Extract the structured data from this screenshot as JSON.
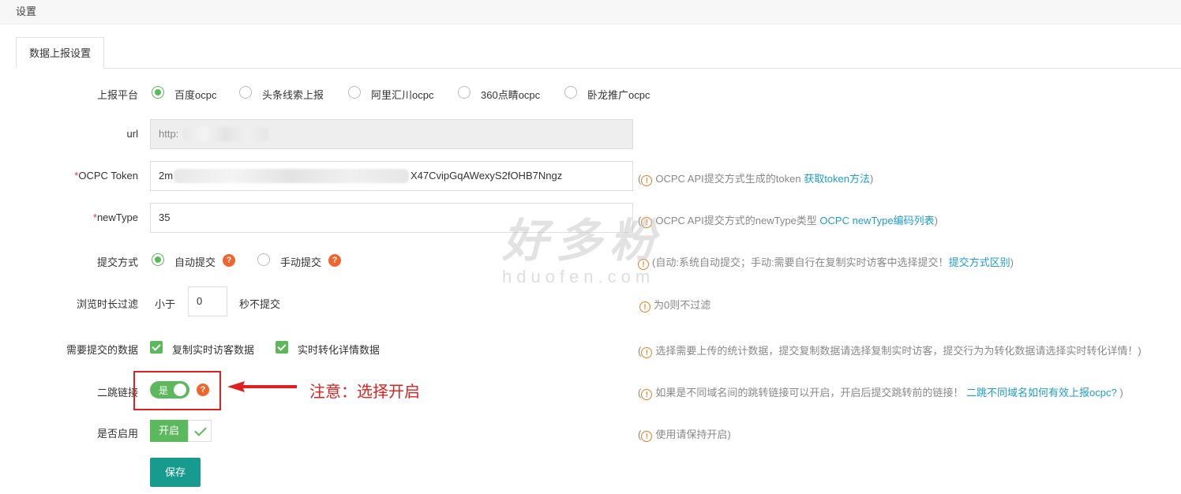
{
  "header": {
    "title": "设置"
  },
  "tab": {
    "label": "数据上报设置"
  },
  "platform": {
    "label": "上报平台",
    "options": [
      "百度ocpc",
      "头条线索上报",
      "阿里汇川ocpc",
      "360点睛ocpc",
      "卧龙推广ocpc"
    ],
    "selected": "百度ocpc"
  },
  "url": {
    "label": "url",
    "value": "http:"
  },
  "token": {
    "label": "OCPC Token",
    "required": "*",
    "value_start": "2m",
    "value_end": "X47CvipGqAWexyS2fOHB7Nngz",
    "hint": "OCPC API提交方式生成的token",
    "hint_link": "获取token方法"
  },
  "newtype": {
    "label": "newType",
    "required": "*",
    "value": "35",
    "hint": "OCPC API提交方式的newType类型",
    "hint_link": "OCPC newType编码列表"
  },
  "submit_mode": {
    "label": "提交方式",
    "options": [
      "自动提交",
      "手动提交"
    ],
    "selected": "自动提交",
    "hint": "(自动:系统自动提交；手动:需要自行在复制实时访客中选择提交！",
    "hint_link": "提交方式区别",
    "hint_end": ")"
  },
  "browse_filter": {
    "label": "浏览时长过滤",
    "prefix": "小于",
    "value": "0",
    "suffix": "秒不提交",
    "hint": "为0则不过滤"
  },
  "data_submit": {
    "label": "需要提交的数据",
    "options": [
      "复制实时访客数据",
      "实时转化详情数据"
    ],
    "hint": "选择需要上传的统计数据，提交复制数据请选择复制实时访客，提交行为为转化数据请选择实时转化详情！",
    "hint_end": ")"
  },
  "jump_link": {
    "label": "二跳链接",
    "toggle_label": "是",
    "toggle_on": true,
    "hint": "如果是不同域名间的跳转链接可以开启，开启后提交跳转前的链接！",
    "hint_link": "二跳不同域名如何有效上报ocpc?",
    "hint_end": ")"
  },
  "enabled": {
    "label": "是否启用",
    "button": "开启",
    "hint": "使用请保持开启)"
  },
  "save_button": "保存",
  "annotation": "注意：选择开启",
  "watermark": {
    "main": "好多粉",
    "sub": "hduofen.com"
  },
  "colors": {
    "accent": "#5cb85c",
    "save": "#189b8f",
    "link": "#1e9ccc",
    "annotation": "#e02020"
  }
}
